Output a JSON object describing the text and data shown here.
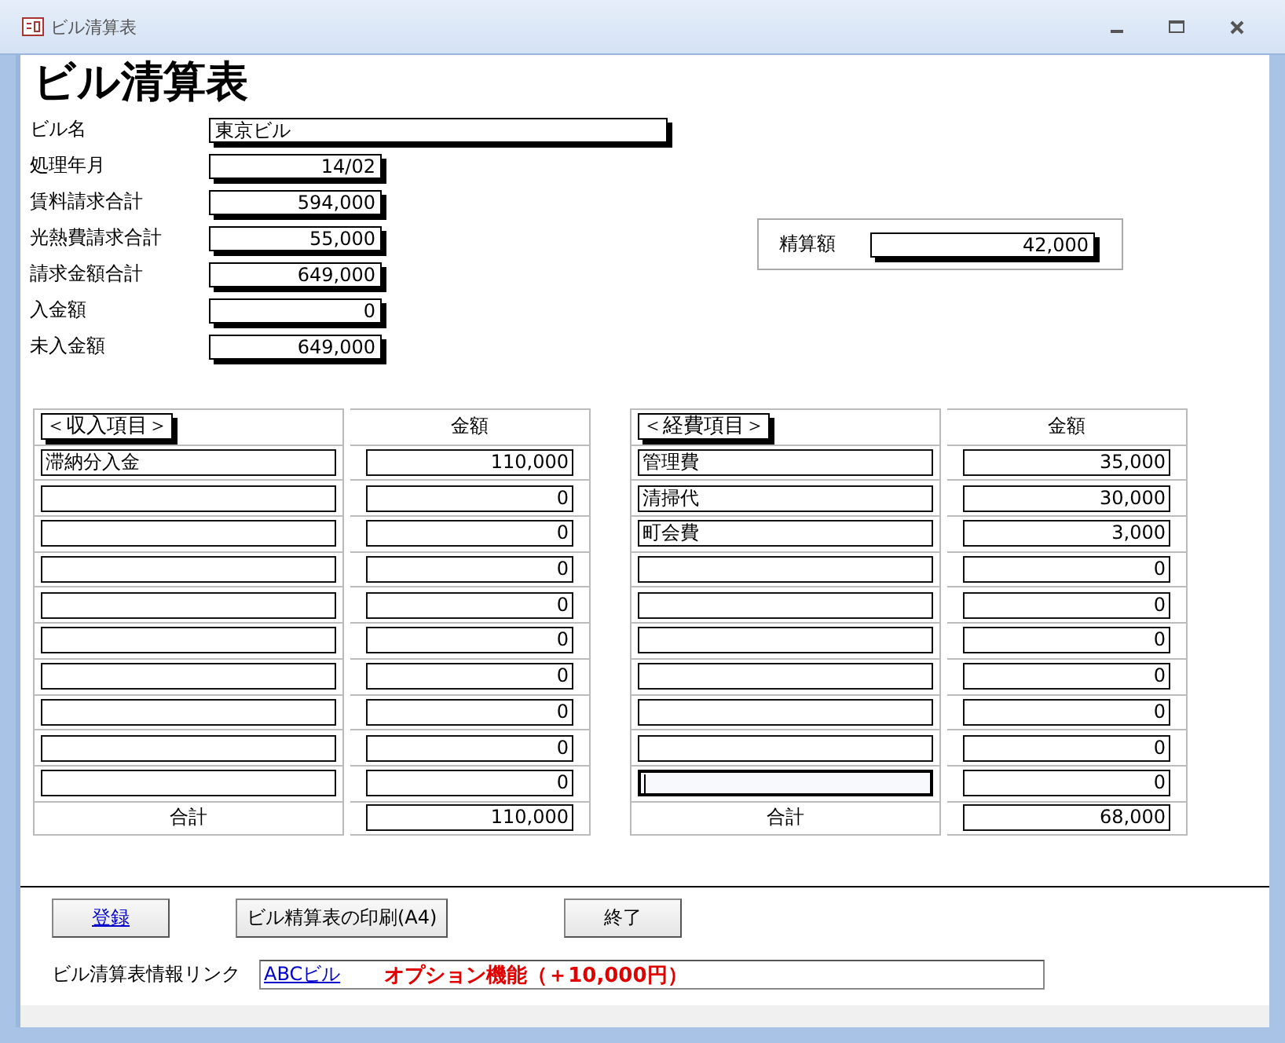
{
  "window": {
    "title": "ビル清算表"
  },
  "heading": "ビル清算表",
  "fields": [
    {
      "label": "ビル名",
      "value": "東京ビル",
      "kind": "text"
    },
    {
      "label": "処理年月",
      "value": "14/02",
      "kind": "number"
    },
    {
      "label": "賃料請求合計",
      "value": "594,000",
      "kind": "number"
    },
    {
      "label": "光熱費請求合計",
      "value": "55,000",
      "kind": "number"
    },
    {
      "label": "請求金額合計",
      "value": "649,000",
      "kind": "number"
    },
    {
      "label": "入金額",
      "value": "0",
      "kind": "number"
    },
    {
      "label": "未入金額",
      "value": "649,000",
      "kind": "number"
    }
  ],
  "settlement": {
    "label": "精算額",
    "value": "42,000"
  },
  "tables": [
    {
      "header": "＜収入項目＞",
      "amount_header": "金額",
      "total_label": "合計",
      "total": "110,000",
      "rows": [
        {
          "item": "滞納分入金",
          "amount": "110,000",
          "focused": false
        },
        {
          "item": "",
          "amount": "0",
          "focused": false
        },
        {
          "item": "",
          "amount": "0",
          "focused": false
        },
        {
          "item": "",
          "amount": "0",
          "focused": false
        },
        {
          "item": "",
          "amount": "0",
          "focused": false
        },
        {
          "item": "",
          "amount": "0",
          "focused": false
        },
        {
          "item": "",
          "amount": "0",
          "focused": false
        },
        {
          "item": "",
          "amount": "0",
          "focused": false
        },
        {
          "item": "",
          "amount": "0",
          "focused": false
        },
        {
          "item": "",
          "amount": "0",
          "focused": false
        }
      ]
    },
    {
      "header": "＜経費項目＞",
      "amount_header": "金額",
      "total_label": "合計",
      "total": "68,000",
      "rows": [
        {
          "item": "管理費",
          "amount": "35,000",
          "focused": false
        },
        {
          "item": "清掃代",
          "amount": "30,000",
          "focused": false
        },
        {
          "item": "町会費",
          "amount": "3,000",
          "focused": false
        },
        {
          "item": "",
          "amount": "0",
          "focused": false
        },
        {
          "item": "",
          "amount": "0",
          "focused": false
        },
        {
          "item": "",
          "amount": "0",
          "focused": false
        },
        {
          "item": "",
          "amount": "0",
          "focused": false
        },
        {
          "item": "",
          "amount": "0",
          "focused": false
        },
        {
          "item": "",
          "amount": "0",
          "focused": false
        },
        {
          "item": "",
          "amount": "0",
          "focused": true
        }
      ]
    }
  ],
  "buttons": [
    {
      "label": "登録",
      "kind": "hyperlink"
    },
    {
      "label": "ビル精算表の印刷(A4)",
      "kind": "plain"
    },
    {
      "label": "終了",
      "kind": "plain"
    }
  ],
  "link_row": {
    "label": "ビル清算表情報リンク",
    "link": "ABCビル",
    "note": "オプション機能（＋10,000円）"
  }
}
